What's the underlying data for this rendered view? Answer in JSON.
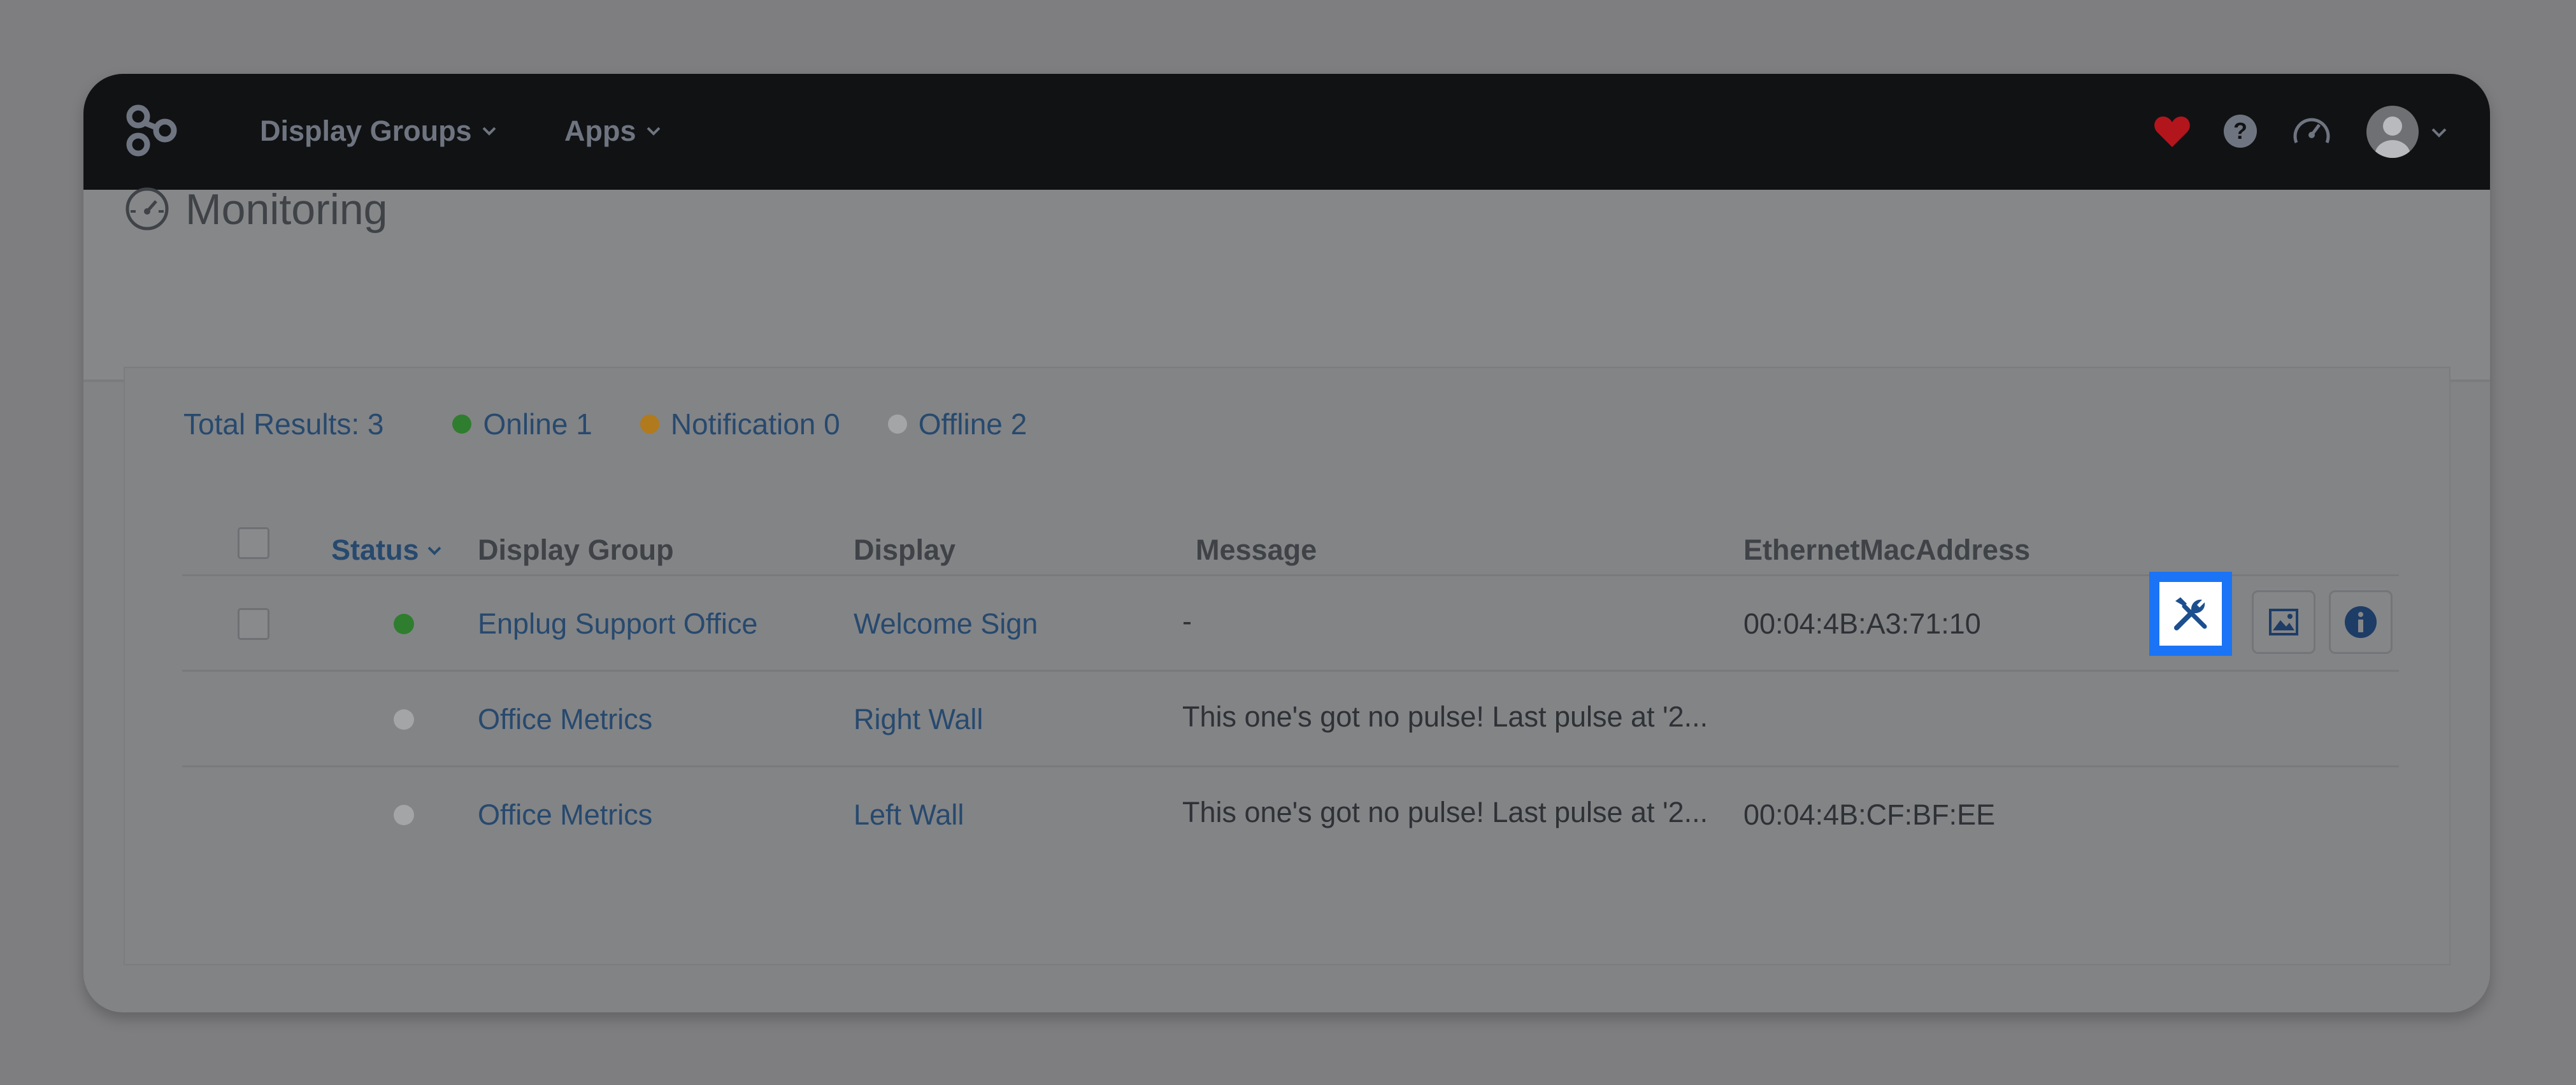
{
  "topbar": {
    "nav": [
      {
        "label": "Display Groups"
      },
      {
        "label": "Apps"
      }
    ],
    "icons": [
      "favorites-heart-icon",
      "help-icon",
      "monitoring-gauge-icon",
      "user-avatar-icon",
      "chevron-down-icon"
    ],
    "colors": {
      "background": "#111214",
      "heart": "#b3151d"
    }
  },
  "page": {
    "title": "Monitoring"
  },
  "summary": {
    "total": "Total Results: 3",
    "online": "Online 1",
    "notification": "Notification 0",
    "offline": "Offline 2",
    "colors": {
      "online": "#2f7d2f",
      "notification": "#b17a1c",
      "offline": "#a3a5a7"
    }
  },
  "table": {
    "headers": {
      "status": "Status",
      "display_group": "Display Group",
      "display": "Display",
      "message": "Message",
      "mac": "EthernetMacAddress"
    },
    "rows": [
      {
        "status": "online",
        "display_group": "Enplug Support Office",
        "display": "Welcome Sign",
        "message": "-",
        "mac": "00:04:4B:A3:71:10"
      },
      {
        "status": "offline",
        "display_group": "Office Metrics",
        "display": "Right Wall",
        "message": "This one's got no pulse! Last pulse at '2...",
        "mac": ""
      },
      {
        "status": "offline",
        "display_group": "Office Metrics",
        "display": "Left Wall",
        "message": "This one's got no pulse! Last pulse at '2...",
        "mac": "00:04:4B:CF:BF:EE"
      }
    ],
    "row_actions": [
      "tools-icon",
      "image-icon",
      "info-icon"
    ],
    "highlight_color": "#1a74f5"
  }
}
